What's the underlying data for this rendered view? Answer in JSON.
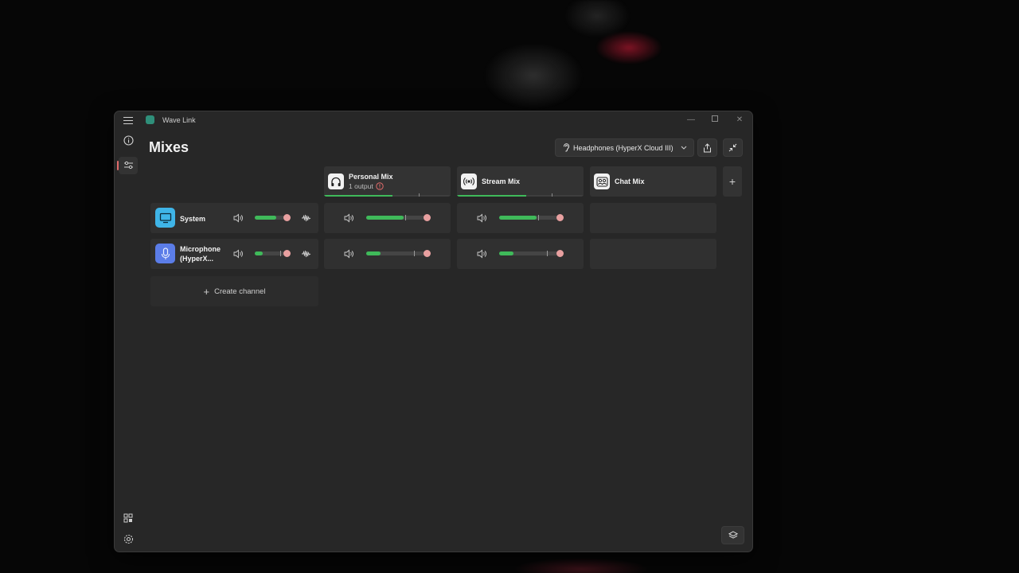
{
  "window": {
    "title": "Wave Link"
  },
  "page": {
    "title": "Mixes"
  },
  "toolbar": {
    "output_device": "Headphones (HyperX Cloud III)"
  },
  "mixes": [
    {
      "name": "Personal Mix",
      "subtitle": "1 output",
      "level": 0.54
    },
    {
      "name": "Stream Mix",
      "subtitle": "",
      "level": 0.55
    },
    {
      "name": "Chat Mix",
      "subtitle": ""
    }
  ],
  "channels": [
    {
      "name": "System",
      "icon": "monitor-icon",
      "color": "#3fb5e8",
      "input_level": 0.72,
      "mix_levels": [
        0.62,
        0.62
      ]
    },
    {
      "name": "Microphone (HyperX...",
      "name_line1": "Microphone",
      "name_line2": "(HyperX...",
      "icon": "microphone-icon",
      "color": "#5b7de8",
      "input_level": 0.24,
      "mix_levels": [
        0.24,
        0.24
      ]
    }
  ],
  "create_channel": {
    "label": "Create channel"
  },
  "colors": {
    "accent_green": "#3fba5a",
    "knob": "#e8a0a0",
    "active_rail": "#e06a6a"
  }
}
